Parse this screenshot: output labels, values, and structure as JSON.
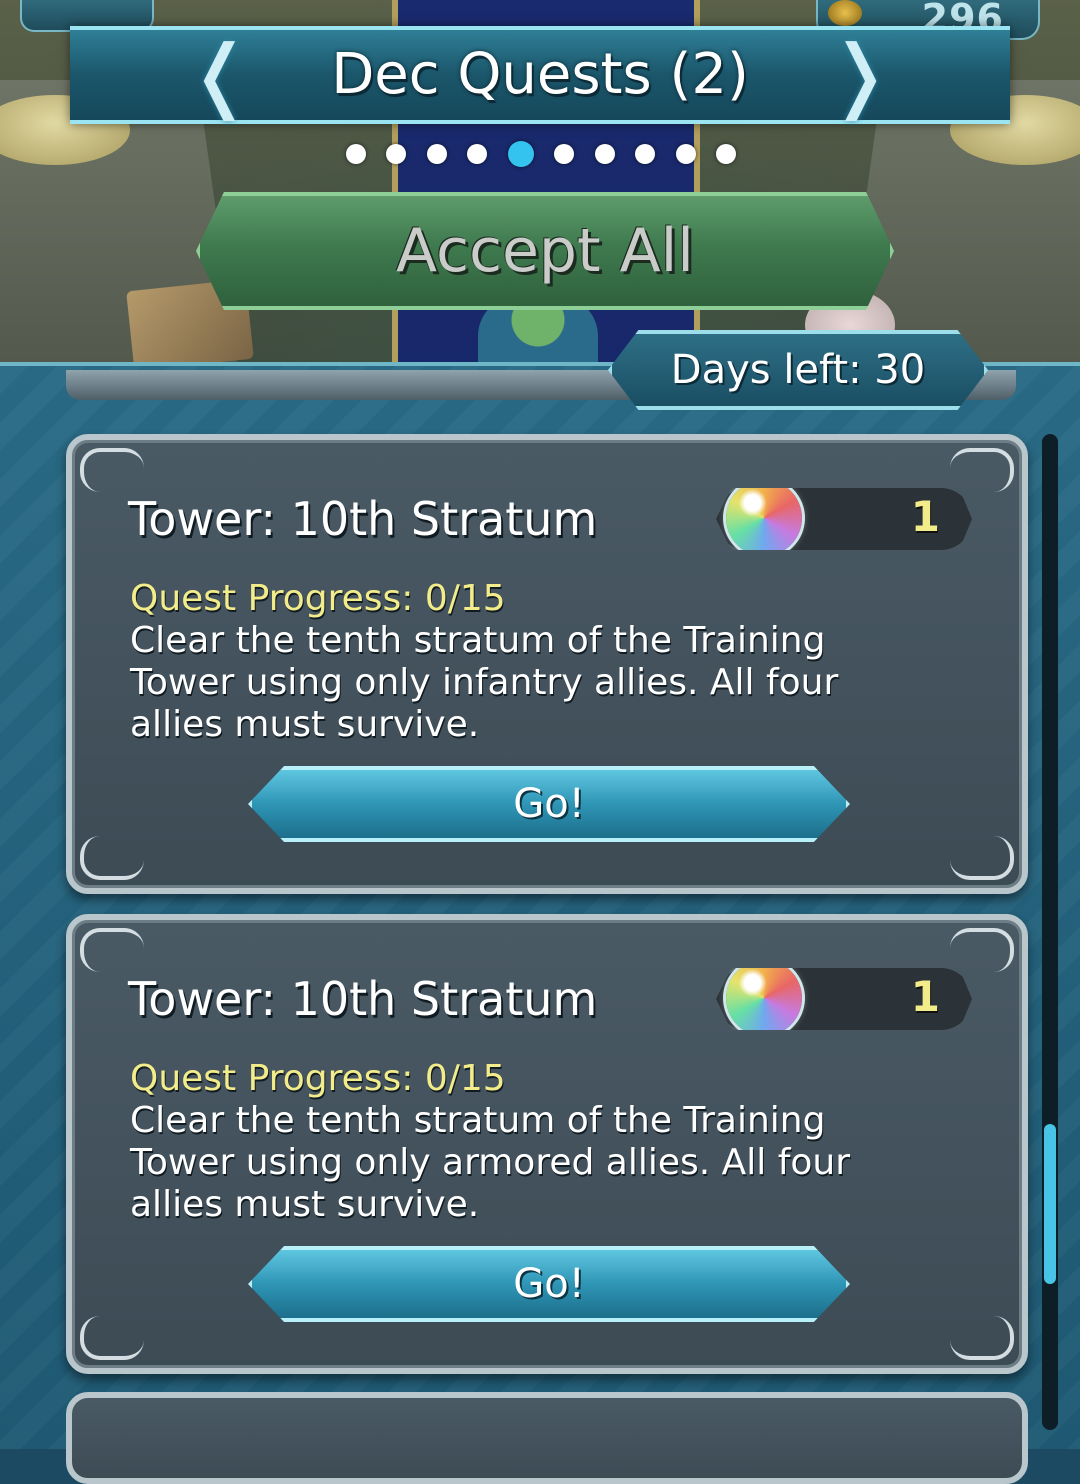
{
  "header": {
    "title": "Dec Quests (2)",
    "orb_count": "296",
    "page_dots": {
      "count": 10,
      "active_index": 4
    },
    "accept_all_label": "Accept All",
    "days_left": "Days left: 30"
  },
  "quests": [
    {
      "title": "Tower: 10th Stratum",
      "reward_icon": "orb-icon",
      "reward_qty": "1",
      "progress": "Quest Progress: 0/15",
      "description": "Clear the tenth stratum of the Training Tower using only infantry allies. All four allies must survive.",
      "button_label": "Go!"
    },
    {
      "title": "Tower: 10th Stratum",
      "reward_icon": "orb-icon",
      "reward_qty": "1",
      "progress": "Quest Progress: 0/15",
      "description": "Clear the tenth stratum of the Training Tower using only armored allies. All four allies must survive.",
      "button_label": "Go!"
    }
  ],
  "colors": {
    "accent": "#33c3ee",
    "progress_text": "#f2ec8a",
    "accept_button": "#3f7a4e"
  }
}
